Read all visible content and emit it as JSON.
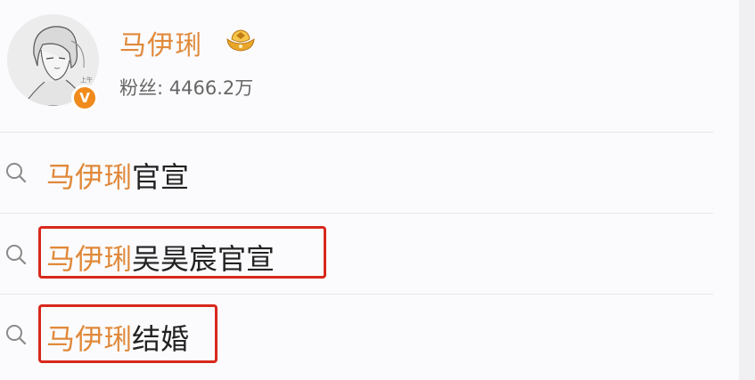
{
  "profile": {
    "name": "马伊琍",
    "followers_label": "粉丝:",
    "followers_count": "4466.2万",
    "verified_mark": "V",
    "avatar_icon": "avatar-illustration",
    "vip_icon": "gold-ingot-icon"
  },
  "suggestions": [
    {
      "highlight": "马伊琍",
      "rest": "官宣",
      "boxed": false
    },
    {
      "highlight": "马伊琍",
      "rest": "吴昊宸官宣",
      "boxed": true
    },
    {
      "highlight": "马伊琍",
      "rest": "结婚",
      "boxed": true
    }
  ],
  "colors": {
    "accent": "#e0893a",
    "box": "#d8281c",
    "text": "#222222",
    "muted": "#666666"
  }
}
